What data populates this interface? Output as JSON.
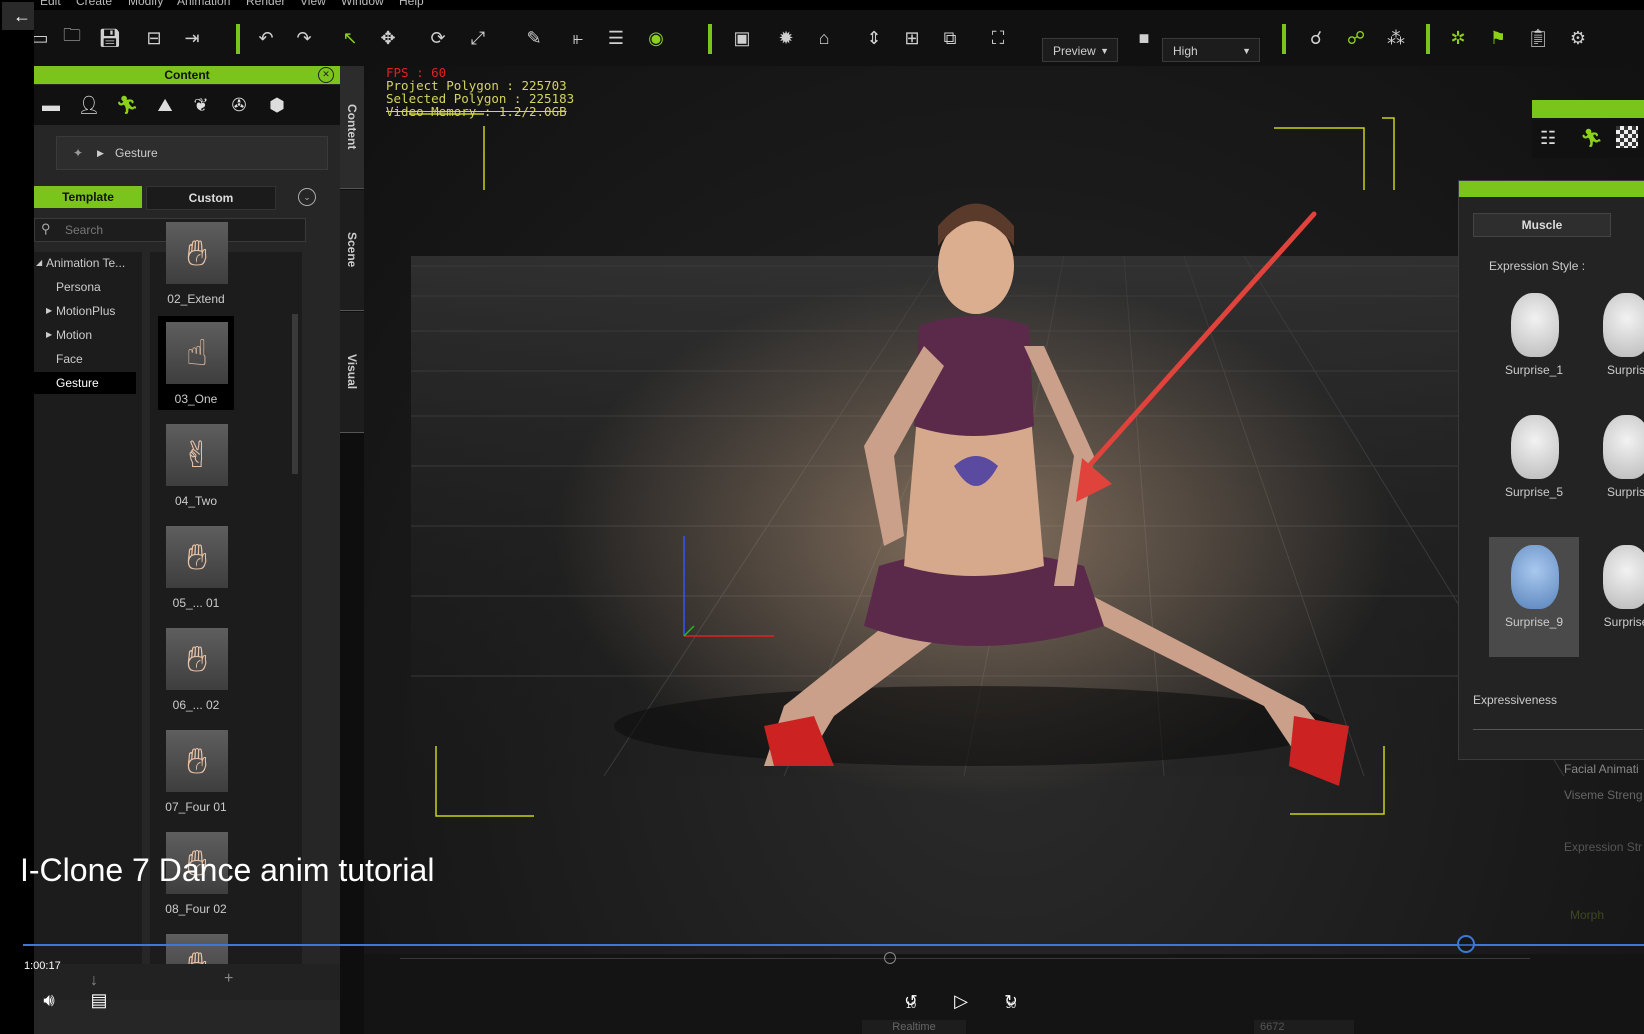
{
  "menu": [
    "Edit",
    "Create",
    "Modify",
    "Animation",
    "Render",
    "View",
    "Window",
    "Help"
  ],
  "toolbar": {
    "render_mode": "Preview",
    "quality": "High",
    "icons": [
      "new-file-icon",
      "open-folder-icon",
      "save-icon",
      "export-icon",
      "import-icon",
      "undo-icon",
      "redo-icon",
      "select-arrow-icon",
      "move-icon",
      "rotate-icon",
      "scale-icon",
      "eyedropper-icon",
      "align-left-icon",
      "align-center-icon",
      "eye-icon",
      "panel-icon",
      "light-icon",
      "home-icon",
      "fit-icon",
      "zoom-extents-icon",
      "camera-frame-icon",
      "fullscreen-icon",
      "video-camera-icon",
      "bone-icon",
      "bone-add-icon",
      "cubes-icon",
      "character-green-icon",
      "flag-icon",
      "clipboard-icon",
      "settings-bone-icon"
    ]
  },
  "content_panel": {
    "title": "Content",
    "breadcrumb": "Gesture",
    "tab_template": "Template",
    "tab_custom": "Custom",
    "search_placeholder": "Search",
    "tree": [
      {
        "label": "Animation Te...",
        "expander": "◢"
      },
      {
        "label": "Persona",
        "expander": ""
      },
      {
        "label": "MotionPlus",
        "expander": "▶"
      },
      {
        "label": "Motion",
        "expander": "▶"
      },
      {
        "label": "Face",
        "expander": ""
      },
      {
        "label": "Gesture",
        "expander": ""
      }
    ],
    "thumbnails": [
      "02_Extend",
      "03_One",
      "04_Two",
      "05_... 01",
      "06_... 02",
      "07_Four 01",
      "08_Four 02",
      ""
    ]
  },
  "side_tabs": [
    "Content",
    "Scene",
    "Visual"
  ],
  "viewport_stats": {
    "fps": "FPS : 60",
    "project_polygon": "Project Polygon : 225703",
    "selected_polygon": "Selected Polygon : 225183",
    "video_memory": "Video Memory : 1.2/2.0GB"
  },
  "face_panel": {
    "tab": "Muscle",
    "expression_style": "Expression Style :",
    "faces": [
      {
        "label": "Surprise_1"
      },
      {
        "label": "Surpris"
      },
      {
        "label": "Surprise_5"
      },
      {
        "label": "Surpris"
      },
      {
        "label": "Surprise_9",
        "selected": true
      },
      {
        "label": "Surprise"
      }
    ],
    "expressiveness": "Expressiveness",
    "facial_animation": "Facial Animati",
    "viseme_strength": "Viseme Streng",
    "expression_strength": "Expression Str",
    "morph": "Morph"
  },
  "playback": {
    "realtime": "Realtime",
    "frame": "6672"
  },
  "video": {
    "title": "I-Clone 7 Dance anim tutorial",
    "time": "1:00:17",
    "progress": 0.89,
    "skip_back": "10",
    "skip_fwd": "30"
  },
  "colors": {
    "accent": "#7bc41c",
    "arrow": "#e0433b",
    "seek": "#3b78d8"
  }
}
